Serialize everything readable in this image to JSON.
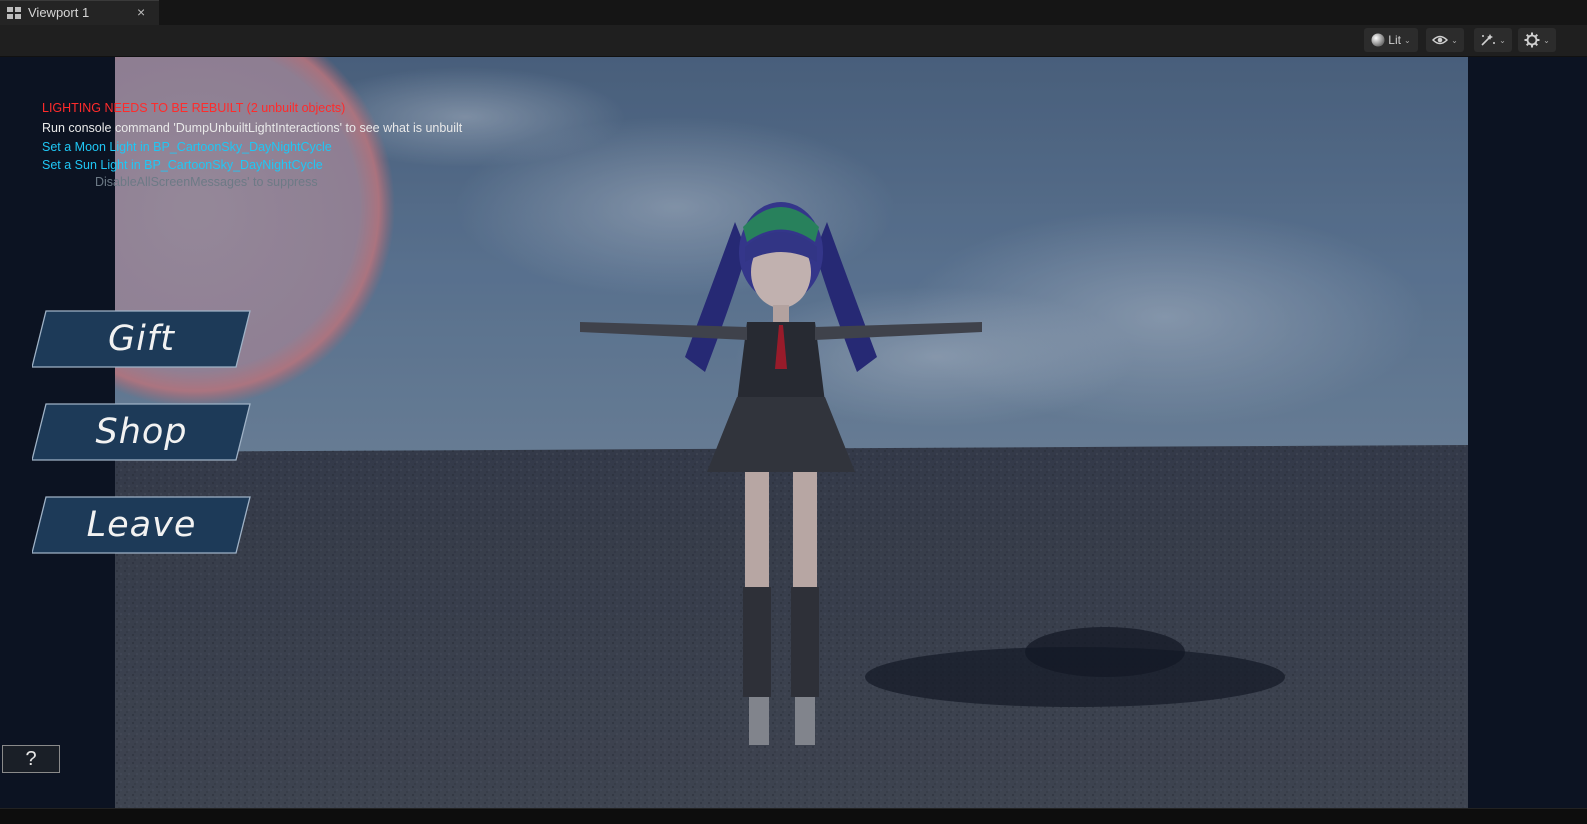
{
  "tab": {
    "label": "Viewport 1",
    "close": "×"
  },
  "toolbar": {
    "view_mode_label": "Lit",
    "view_mode_icon": "lit-sphere-icon",
    "show_icon": "eye-icon",
    "realtime_icon": "realtime-sparkle-icon",
    "settings_icon": "gear-icon",
    "dropdown_icon": "chevron-down-icon"
  },
  "messages": {
    "lighting_warning": "LIGHTING NEEDS TO BE REBUILT (2 unbuilt objects)",
    "console_hint": "Run console command 'DumpUnbuiltLightInteractions' to see what is unbuilt",
    "moon_light": "Set a Moon Light in BP_CartoonSky_DayNightCycle",
    "sun_light": "Set a Sun Light in BP_CartoonSky_DayNightCycle",
    "suppress_hint": "DisableAllScreenMessages' to suppress"
  },
  "menu": {
    "gift_label": "Gift",
    "shop_label": "Shop",
    "leave_label": "Leave"
  },
  "help": {
    "label": "?"
  },
  "colors": {
    "warning_red": "#ff2b2b",
    "info_cyan": "#1fc7f5",
    "button_fill": "#1d3a58"
  }
}
